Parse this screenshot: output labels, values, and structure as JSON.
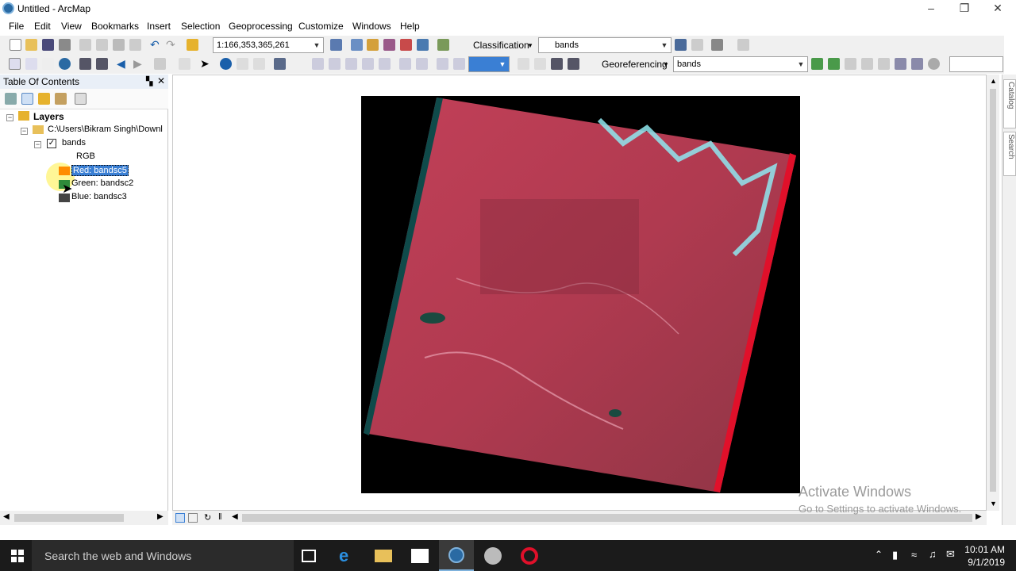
{
  "window": {
    "title": "Untitled - ArcMap"
  },
  "menu": [
    "File",
    "Edit",
    "View",
    "Bookmarks",
    "Insert",
    "Selection",
    "Geoprocessing",
    "Customize",
    "Windows",
    "Help"
  ],
  "toolbar": {
    "scale": "1:166,353,365,261",
    "classification_label": "Classification",
    "classification_layer": "bands",
    "georeferencing_label": "Georeferencing",
    "georeferencing_layer": "bands"
  },
  "toc": {
    "title": "Table Of Contents",
    "layers_label": "Layers",
    "path": "C:\\Users\\Bikram Singh\\Downl",
    "layer_name": "bands",
    "renderer": "RGB",
    "bands": [
      {
        "label": "Red:   bandsc5",
        "color": "#ff8c00"
      },
      {
        "label": "Green: bandsc2",
        "color": "#2e8b3a"
      },
      {
        "label": "Blue:  bandsc3",
        "color": "#444444"
      }
    ]
  },
  "dock": {
    "catalog": "Catalog",
    "search": "Search"
  },
  "watermark": {
    "line1": "Activate Windows",
    "line2": "Go to Settings to activate Windows."
  },
  "taskbar": {
    "search_placeholder": "Search the web and Windows",
    "time": "10:01 AM",
    "date": "9/1/2019"
  }
}
